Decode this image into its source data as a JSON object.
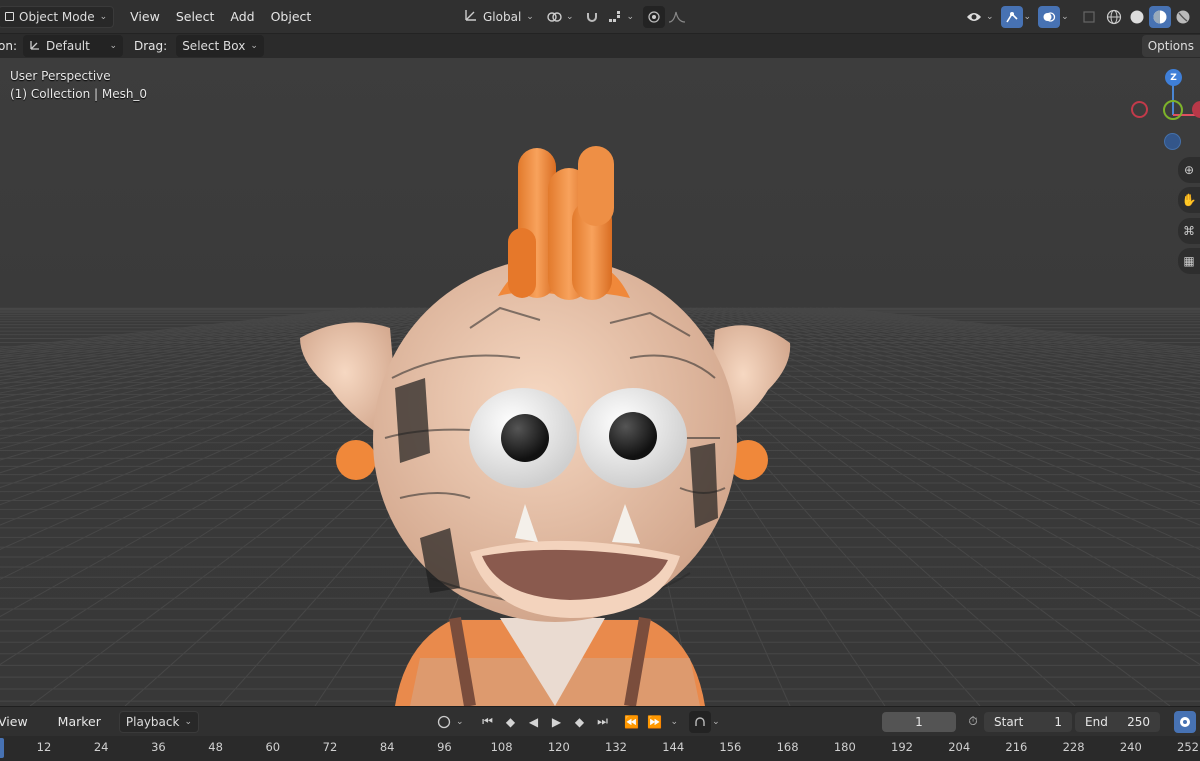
{
  "header": {
    "mode": "Object Mode",
    "menus": [
      "View",
      "Select",
      "Add",
      "Object"
    ],
    "orientation": "Global"
  },
  "tool_settings": {
    "orientation_label": "on:",
    "orientation_value": "Default",
    "drag_label": "Drag:",
    "drag_value": "Select Box",
    "options": "Options"
  },
  "viewport": {
    "perspective": "User Perspective",
    "collection": "(1) Collection | Mesh_0",
    "gizmo_z": "Z"
  },
  "timeline": {
    "menus": [
      "View",
      "Marker",
      "Playback"
    ],
    "current_frame": "1",
    "start_label": "Start",
    "start_value": "1",
    "end_label": "End",
    "end_value": "250",
    "ruler": [
      "12",
      "24",
      "36",
      "48",
      "60",
      "72",
      "84",
      "96",
      "108",
      "120",
      "132",
      "144",
      "156",
      "168",
      "180",
      "192",
      "204",
      "216",
      "228",
      "240",
      "252"
    ]
  },
  "colors": {
    "accent": "#4772b3",
    "header_bg": "#303030",
    "viewport_bg": "#3d3d3d",
    "hair": "#f0883a",
    "skin": "#f1c9ae"
  }
}
